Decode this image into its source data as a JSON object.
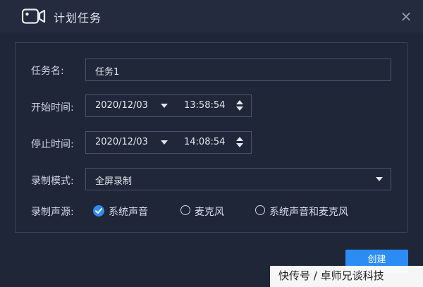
{
  "window": {
    "title": "计划任务",
    "title_icon": "camera-icon",
    "close_icon": "close-icon",
    "close_glyph": "×"
  },
  "form": {
    "task_name": {
      "label": "任务名:",
      "value": "任务1"
    },
    "start_time": {
      "label": "开始时间:",
      "date": "2020/12/03",
      "time": "13:58:54"
    },
    "stop_time": {
      "label": "停止时间:",
      "date": "2020/12/03",
      "time": "14:08:54"
    },
    "record_mode": {
      "label": "录制模式:",
      "selected": "全屏录制"
    },
    "audio_source": {
      "label": "录制声源:",
      "options": [
        {
          "label": "系统声音",
          "checked": true
        },
        {
          "label": "麦克风",
          "checked": false
        },
        {
          "label": "系统声音和麦克风",
          "checked": false
        }
      ]
    }
  },
  "actions": {
    "create_label": "创建"
  },
  "watermark": "快传号 / 卓师兄谈科技",
  "colors": {
    "background": "#1f2638",
    "accent": "#2b8cf5",
    "border": "#4a5468"
  }
}
